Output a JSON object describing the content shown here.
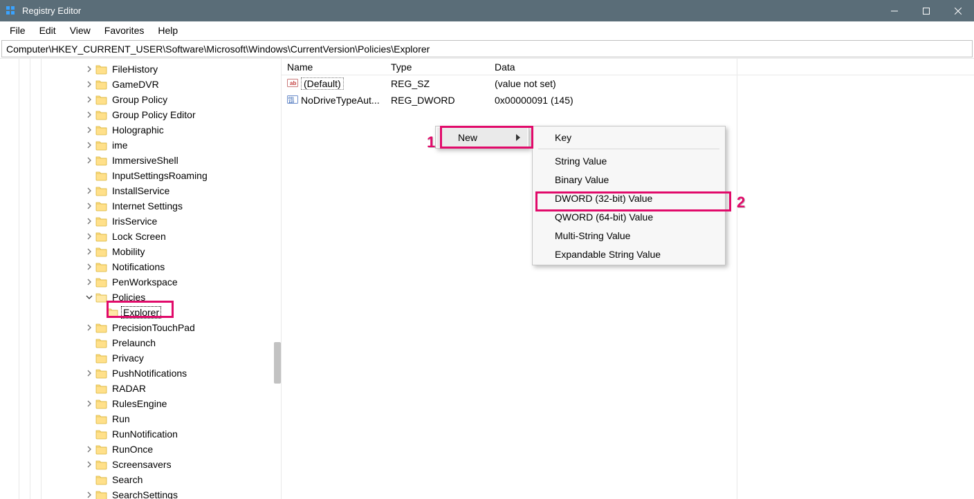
{
  "window": {
    "title": "Registry Editor"
  },
  "menu": {
    "file": "File",
    "edit": "Edit",
    "view": "View",
    "favorites": "Favorites",
    "help": "Help"
  },
  "address": {
    "path": "Computer\\HKEY_CURRENT_USER\\Software\\Microsoft\\Windows\\CurrentVersion\\Policies\\Explorer"
  },
  "tree": {
    "items": [
      {
        "depth": 7,
        "expandable": true,
        "expanded": false,
        "label": "FileHistory"
      },
      {
        "depth": 7,
        "expandable": true,
        "expanded": false,
        "label": "GameDVR"
      },
      {
        "depth": 7,
        "expandable": true,
        "expanded": false,
        "label": "Group Policy"
      },
      {
        "depth": 7,
        "expandable": true,
        "expanded": false,
        "label": "Group Policy Editor"
      },
      {
        "depth": 7,
        "expandable": true,
        "expanded": false,
        "label": "Holographic"
      },
      {
        "depth": 7,
        "expandable": true,
        "expanded": false,
        "label": "ime"
      },
      {
        "depth": 7,
        "expandable": true,
        "expanded": false,
        "label": "ImmersiveShell"
      },
      {
        "depth": 7,
        "expandable": false,
        "expanded": false,
        "label": "InputSettingsRoaming"
      },
      {
        "depth": 7,
        "expandable": true,
        "expanded": false,
        "label": "InstallService"
      },
      {
        "depth": 7,
        "expandable": true,
        "expanded": false,
        "label": "Internet Settings"
      },
      {
        "depth": 7,
        "expandable": true,
        "expanded": false,
        "label": "IrisService"
      },
      {
        "depth": 7,
        "expandable": true,
        "expanded": false,
        "label": "Lock Screen"
      },
      {
        "depth": 7,
        "expandable": true,
        "expanded": false,
        "label": "Mobility"
      },
      {
        "depth": 7,
        "expandable": true,
        "expanded": false,
        "label": "Notifications"
      },
      {
        "depth": 7,
        "expandable": true,
        "expanded": false,
        "label": "PenWorkspace"
      },
      {
        "depth": 7,
        "expandable": true,
        "expanded": true,
        "label": "Policies"
      },
      {
        "depth": 8,
        "expandable": false,
        "expanded": false,
        "label": "Explorer",
        "selected": true
      },
      {
        "depth": 7,
        "expandable": true,
        "expanded": false,
        "label": "PrecisionTouchPad"
      },
      {
        "depth": 7,
        "expandable": false,
        "expanded": false,
        "label": "Prelaunch"
      },
      {
        "depth": 7,
        "expandable": false,
        "expanded": false,
        "label": "Privacy"
      },
      {
        "depth": 7,
        "expandable": true,
        "expanded": false,
        "label": "PushNotifications"
      },
      {
        "depth": 7,
        "expandable": false,
        "expanded": false,
        "label": "RADAR"
      },
      {
        "depth": 7,
        "expandable": true,
        "expanded": false,
        "label": "RulesEngine"
      },
      {
        "depth": 7,
        "expandable": false,
        "expanded": false,
        "label": "Run"
      },
      {
        "depth": 7,
        "expandable": false,
        "expanded": false,
        "label": "RunNotification"
      },
      {
        "depth": 7,
        "expandable": true,
        "expanded": false,
        "label": "RunOnce"
      },
      {
        "depth": 7,
        "expandable": true,
        "expanded": false,
        "label": "Screensavers"
      },
      {
        "depth": 7,
        "expandable": false,
        "expanded": false,
        "label": "Search"
      },
      {
        "depth": 7,
        "expandable": true,
        "expanded": false,
        "label": "SearchSettings"
      }
    ]
  },
  "list": {
    "columns": {
      "name": "Name",
      "type": "Type",
      "data": "Data"
    },
    "rows": [
      {
        "icon": "string",
        "name": "(Default)",
        "type": "REG_SZ",
        "data": "(value not set)",
        "focused": true
      },
      {
        "icon": "dword",
        "name": "NoDriveTypeAut...",
        "type": "REG_DWORD",
        "data": "0x00000091 (145)",
        "focused": false
      }
    ]
  },
  "context_primary": {
    "new": "New"
  },
  "context_submenu": {
    "key": "Key",
    "string": "String Value",
    "binary": "Binary Value",
    "dword": "DWORD (32-bit) Value",
    "qword": "QWORD (64-bit) Value",
    "multistring": "Multi-String Value",
    "expandable": "Expandable String Value"
  },
  "annotations": {
    "one": "1",
    "two": "2"
  }
}
